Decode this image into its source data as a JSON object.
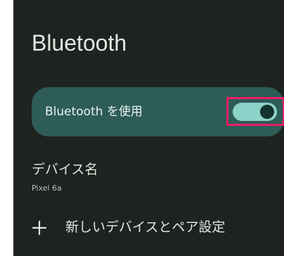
{
  "screen": {
    "title": "Bluetooth"
  },
  "bluetooth": {
    "use_label": "Bluetooth を使用",
    "enabled": true,
    "toggle_color": "#8ed1c8",
    "highlight_color": "#e91e63"
  },
  "device_name": {
    "title": "デバイス名",
    "value": "Pixel 6a"
  },
  "pair": {
    "label": "新しいデバイスとペア設定",
    "icon": "plus-icon"
  }
}
